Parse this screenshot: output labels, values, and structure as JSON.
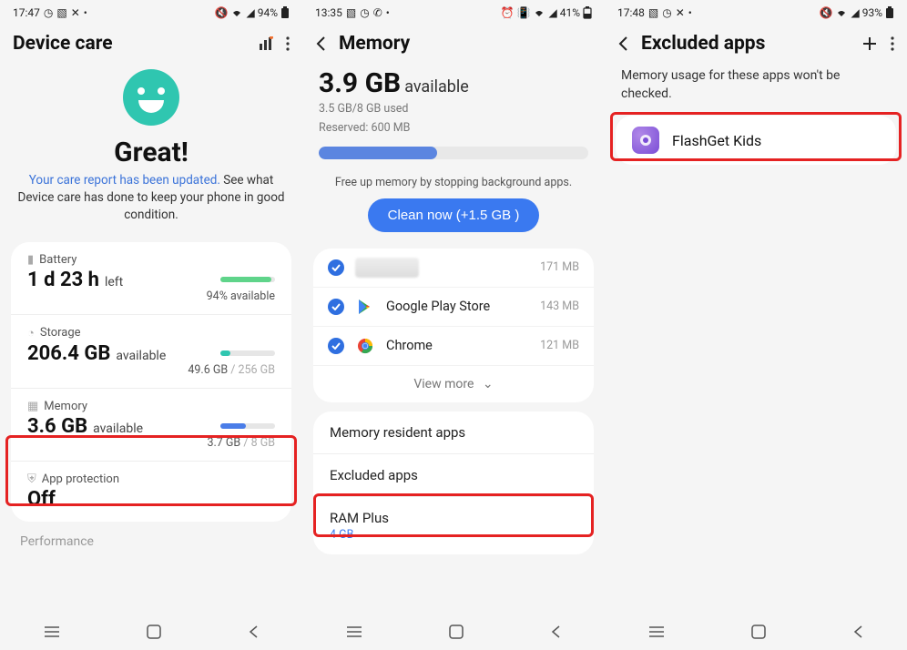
{
  "screen1": {
    "time": "17:47",
    "battery_pct": "94%",
    "title": "Device care",
    "status_word": "Great!",
    "sub_blue": "Your care report has been updated.",
    "sub_rest": " See what Device care has done to keep your phone in good condition.",
    "battery": {
      "label": "Battery",
      "value": "1 d 23 h",
      "unit": "left",
      "available": "94% available"
    },
    "storage": {
      "label": "Storage",
      "value": "206.4 GB",
      "unit": "available",
      "used": "49.6 GB",
      "total": "/ 256 GB"
    },
    "memory": {
      "label": "Memory",
      "value": "3.6 GB",
      "unit": "available",
      "used": "3.7 GB",
      "total": "/ 8 GB"
    },
    "app_protection": {
      "label": "App protection",
      "value": "Off"
    },
    "performance": "Performance"
  },
  "screen2": {
    "time": "13:35",
    "battery_pct": "41%",
    "title": "Memory",
    "avail_value": "3.9 GB",
    "avail_label": "available",
    "used_line": "3.5 GB/8 GB used",
    "reserved_line": "Reserved: 600 MB",
    "tip": "Free up memory by stopping background apps.",
    "clean_btn": "Clean now (+1.5 GB )",
    "apps": [
      {
        "name": "",
        "size": "171 MB"
      },
      {
        "name": "Google Play Store",
        "size": "143 MB"
      },
      {
        "name": "Chrome",
        "size": "121 MB"
      }
    ],
    "viewmore": "View more",
    "resident": "Memory resident apps",
    "excluded": "Excluded apps",
    "ramplus": "RAM Plus",
    "ramplus_sub": "4 GB"
  },
  "screen3": {
    "time": "17:48",
    "battery_pct": "93%",
    "title": "Excluded apps",
    "desc": "Memory usage for these apps won't be checked.",
    "app": "FlashGet Kids"
  }
}
